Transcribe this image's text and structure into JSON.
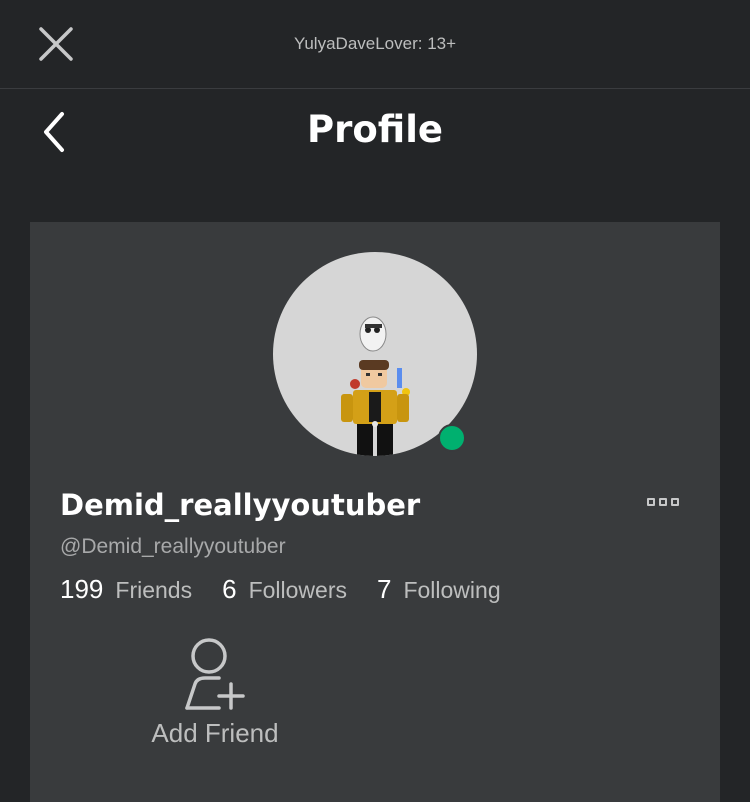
{
  "topbar": {
    "account_label": "YulyaDaveLover: 13+",
    "close_icon": "close-icon"
  },
  "header": {
    "title": "Profile",
    "back_icon": "chevron-left-icon"
  },
  "profile": {
    "display_name": "Demid_reallyyoutuber",
    "username": "@Demid_reallyyoutuber",
    "presence_color": "#00b06f",
    "more_icon": "more-options-icon",
    "stats": [
      {
        "value": "199",
        "label": "Friends"
      },
      {
        "value": "6",
        "label": "Followers"
      },
      {
        "value": "7",
        "label": "Following"
      }
    ],
    "actions": {
      "add_friend_label": "Add Friend",
      "add_friend_icon": "add-friend-icon"
    }
  },
  "colors": {
    "background": "#232527",
    "card": "#393b3d",
    "online": "#00b06f"
  }
}
